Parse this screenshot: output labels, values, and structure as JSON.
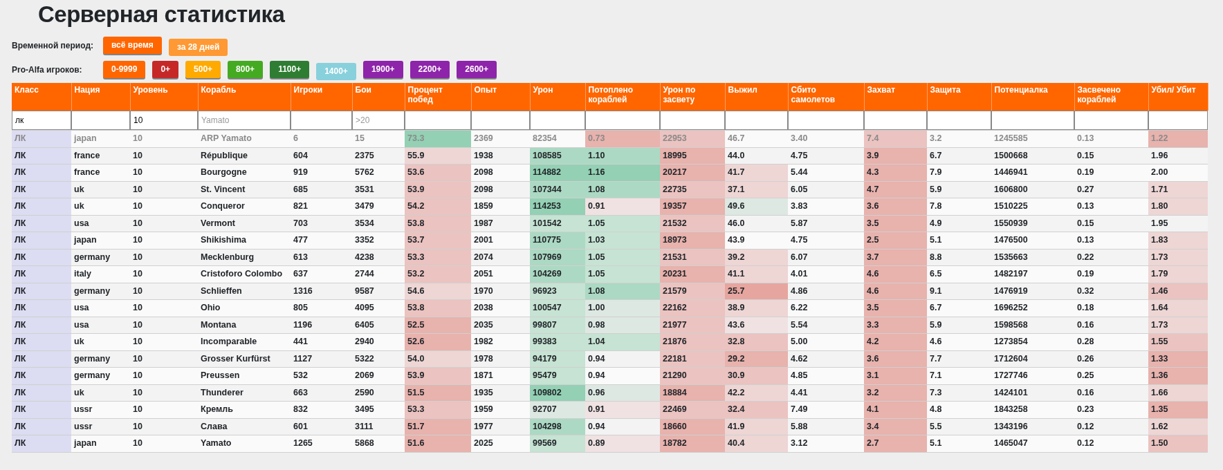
{
  "title": "Серверная статистика",
  "period": {
    "label": "Временной период:",
    "options": [
      {
        "label": "всё время",
        "selected": true,
        "color": "#ff6600"
      },
      {
        "label": "за 28 дней",
        "selected": false,
        "color": "#ff9933"
      }
    ]
  },
  "pro_alfa": {
    "label": "Pro-Alfa игроков:",
    "options": [
      {
        "label": "0-9999",
        "selected": true,
        "color": "#ff6600"
      },
      {
        "label": "0+",
        "selected": true,
        "color": "#c62828"
      },
      {
        "label": "500+",
        "selected": true,
        "color": "#ffaa00"
      },
      {
        "label": "800+",
        "selected": true,
        "color": "#44aa22"
      },
      {
        "label": "1100+",
        "selected": true,
        "color": "#2e7d32"
      },
      {
        "label": "1400+",
        "selected": false,
        "color": "#88d0dc"
      },
      {
        "label": "1900+",
        "selected": true,
        "color": "#8e24aa"
      },
      {
        "label": "2200+",
        "selected": true,
        "color": "#8e24aa"
      },
      {
        "label": "2600+",
        "selected": true,
        "color": "#8e24aa"
      }
    ]
  },
  "table": {
    "columns": [
      {
        "label": "Класс",
        "filter": "лк"
      },
      {
        "label": "Нация"
      },
      {
        "label": "Уровень",
        "filter": "10"
      },
      {
        "label": "Корабль",
        "placeholder": "Yamato"
      },
      {
        "label": "Игроки"
      },
      {
        "label": "Бои",
        "placeholder": ">20"
      },
      {
        "label": "Процент побед"
      },
      {
        "label": "Опыт"
      },
      {
        "label": "Урон"
      },
      {
        "label": "Потоплено кораблей"
      },
      {
        "label": "Урон по засвету"
      },
      {
        "label": "Выжил"
      },
      {
        "label": "Сбито самолетов"
      },
      {
        "label": "Захват"
      },
      {
        "label": "Защита"
      },
      {
        "label": "Потенциалка"
      },
      {
        "label": "Засвечено кораблей"
      },
      {
        "label": "Убил/ Убит"
      }
    ],
    "rows": [
      {
        "muted": true,
        "cells": [
          {
            "text": "ЛК"
          },
          {
            "text": "japan"
          },
          {
            "text": "10"
          },
          {
            "text": "ARP Yamato"
          },
          {
            "text": "6"
          },
          {
            "text": "15"
          },
          {
            "text": "73.3",
            "color": "#93d0b4"
          },
          {
            "text": "2369"
          },
          {
            "text": "82354"
          },
          {
            "text": "0.73",
            "color": "#e8b2ad"
          },
          {
            "text": "22953",
            "color": "#ebc3c0"
          },
          {
            "text": "46.7"
          },
          {
            "text": "3.40"
          },
          {
            "text": "7.4",
            "color": "#ebc3c0"
          },
          {
            "text": "3.2"
          },
          {
            "text": "1245585"
          },
          {
            "text": "0.13"
          },
          {
            "text": "1.22",
            "color": "#e8b2ad"
          }
        ]
      },
      {
        "muted": false,
        "cells": [
          {
            "text": "ЛК"
          },
          {
            "text": "france"
          },
          {
            "text": "10"
          },
          {
            "text": "République"
          },
          {
            "text": "604"
          },
          {
            "text": "2375"
          },
          {
            "text": "55.9",
            "color": "#eed6d5"
          },
          {
            "text": "1938"
          },
          {
            "text": "108585",
            "color": "#acd9c3"
          },
          {
            "text": "1.10",
            "color": "#acd9c3"
          },
          {
            "text": "18995",
            "color": "#e8b2ad"
          },
          {
            "text": "44.0"
          },
          {
            "text": "4.75"
          },
          {
            "text": "3.9",
            "color": "#e8b2ad"
          },
          {
            "text": "6.7"
          },
          {
            "text": "1500668"
          },
          {
            "text": "0.15"
          },
          {
            "text": "1.96"
          }
        ]
      },
      {
        "muted": false,
        "cells": [
          {
            "text": "ЛК"
          },
          {
            "text": "france"
          },
          {
            "text": "10"
          },
          {
            "text": "Bourgogne"
          },
          {
            "text": "919"
          },
          {
            "text": "5762"
          },
          {
            "text": "53.6",
            "color": "#ebc3c0"
          },
          {
            "text": "2098"
          },
          {
            "text": "114882",
            "color": "#93d0b4"
          },
          {
            "text": "1.16",
            "color": "#93d0b4"
          },
          {
            "text": "20217",
            "color": "#e8b2ad"
          },
          {
            "text": "41.7",
            "color": "#eed6d5"
          },
          {
            "text": "5.44"
          },
          {
            "text": "4.3",
            "color": "#e8b2ad"
          },
          {
            "text": "7.9"
          },
          {
            "text": "1446941"
          },
          {
            "text": "0.19"
          },
          {
            "text": "2.00"
          }
        ]
      },
      {
        "muted": false,
        "cells": [
          {
            "text": "ЛК"
          },
          {
            "text": "uk"
          },
          {
            "text": "10"
          },
          {
            "text": "St. Vincent"
          },
          {
            "text": "685"
          },
          {
            "text": "3531"
          },
          {
            "text": "53.9",
            "color": "#ebc3c0"
          },
          {
            "text": "2098"
          },
          {
            "text": "107344",
            "color": "#acd9c3"
          },
          {
            "text": "1.08",
            "color": "#acd9c3"
          },
          {
            "text": "22735",
            "color": "#ebc3c0"
          },
          {
            "text": "37.1",
            "color": "#eed6d5"
          },
          {
            "text": "6.05"
          },
          {
            "text": "4.7",
            "color": "#e8b2ad"
          },
          {
            "text": "5.9"
          },
          {
            "text": "1606800"
          },
          {
            "text": "0.27"
          },
          {
            "text": "1.71",
            "color": "#eed6d5"
          }
        ]
      },
      {
        "muted": false,
        "cells": [
          {
            "text": "ЛК"
          },
          {
            "text": "uk"
          },
          {
            "text": "10"
          },
          {
            "text": "Conqueror"
          },
          {
            "text": "821"
          },
          {
            "text": "3479"
          },
          {
            "text": "54.2",
            "color": "#ebc3c0"
          },
          {
            "text": "1859"
          },
          {
            "text": "114253",
            "color": "#93d0b4"
          },
          {
            "text": "0.91",
            "color": "#f0e2e2"
          },
          {
            "text": "19357",
            "color": "#e8b2ad"
          },
          {
            "text": "49.6",
            "color": "#dee8e3"
          },
          {
            "text": "3.83"
          },
          {
            "text": "3.6",
            "color": "#e8b2ad"
          },
          {
            "text": "7.8"
          },
          {
            "text": "1510225"
          },
          {
            "text": "0.13"
          },
          {
            "text": "1.80",
            "color": "#eed6d5"
          }
        ]
      },
      {
        "muted": false,
        "cells": [
          {
            "text": "ЛК"
          },
          {
            "text": "usa"
          },
          {
            "text": "10"
          },
          {
            "text": "Vermont"
          },
          {
            "text": "703"
          },
          {
            "text": "3534"
          },
          {
            "text": "53.8",
            "color": "#ebc3c0"
          },
          {
            "text": "1987"
          },
          {
            "text": "101542",
            "color": "#c6e3d3"
          },
          {
            "text": "1.05",
            "color": "#c6e3d3"
          },
          {
            "text": "21532",
            "color": "#ebc3c0"
          },
          {
            "text": "46.0"
          },
          {
            "text": "5.87"
          },
          {
            "text": "3.5",
            "color": "#e8b2ad"
          },
          {
            "text": "4.9"
          },
          {
            "text": "1550939"
          },
          {
            "text": "0.15"
          },
          {
            "text": "1.95"
          }
        ]
      },
      {
        "muted": false,
        "cells": [
          {
            "text": "ЛК"
          },
          {
            "text": "japan"
          },
          {
            "text": "10"
          },
          {
            "text": "Shikishima"
          },
          {
            "text": "477"
          },
          {
            "text": "3352"
          },
          {
            "text": "53.7",
            "color": "#ebc3c0"
          },
          {
            "text": "2001"
          },
          {
            "text": "110775",
            "color": "#acd9c3"
          },
          {
            "text": "1.03",
            "color": "#c6e3d3"
          },
          {
            "text": "18973",
            "color": "#e8b2ad"
          },
          {
            "text": "43.9"
          },
          {
            "text": "4.75"
          },
          {
            "text": "2.5",
            "color": "#e8b2ad"
          },
          {
            "text": "5.1"
          },
          {
            "text": "1476500"
          },
          {
            "text": "0.13"
          },
          {
            "text": "1.83",
            "color": "#eed6d5"
          }
        ]
      },
      {
        "muted": false,
        "cells": [
          {
            "text": "ЛК"
          },
          {
            "text": "germany"
          },
          {
            "text": "10"
          },
          {
            "text": "Mecklenburg"
          },
          {
            "text": "613"
          },
          {
            "text": "4238"
          },
          {
            "text": "53.3",
            "color": "#ebc3c0"
          },
          {
            "text": "2074"
          },
          {
            "text": "107969",
            "color": "#acd9c3"
          },
          {
            "text": "1.05",
            "color": "#c6e3d3"
          },
          {
            "text": "21531",
            "color": "#ebc3c0"
          },
          {
            "text": "39.2",
            "color": "#eed6d5"
          },
          {
            "text": "6.07"
          },
          {
            "text": "3.7",
            "color": "#e8b2ad"
          },
          {
            "text": "8.8"
          },
          {
            "text": "1535663"
          },
          {
            "text": "0.22"
          },
          {
            "text": "1.73",
            "color": "#eed6d5"
          }
        ]
      },
      {
        "muted": false,
        "cells": [
          {
            "text": "ЛК"
          },
          {
            "text": "italy"
          },
          {
            "text": "10"
          },
          {
            "text": "Cristoforo Colombo"
          },
          {
            "text": "637"
          },
          {
            "text": "2744"
          },
          {
            "text": "53.2",
            "color": "#ebc3c0"
          },
          {
            "text": "2051"
          },
          {
            "text": "104269",
            "color": "#acd9c3"
          },
          {
            "text": "1.05",
            "color": "#c6e3d3"
          },
          {
            "text": "20231",
            "color": "#e8b2ad"
          },
          {
            "text": "41.1",
            "color": "#eed6d5"
          },
          {
            "text": "4.01"
          },
          {
            "text": "4.6",
            "color": "#e8b2ad"
          },
          {
            "text": "6.5"
          },
          {
            "text": "1482197"
          },
          {
            "text": "0.19"
          },
          {
            "text": "1.79",
            "color": "#eed6d5"
          }
        ]
      },
      {
        "muted": false,
        "cells": [
          {
            "text": "ЛК"
          },
          {
            "text": "germany"
          },
          {
            "text": "10"
          },
          {
            "text": "Schlieffen"
          },
          {
            "text": "1316"
          },
          {
            "text": "9587"
          },
          {
            "text": "54.6",
            "color": "#eed6d5"
          },
          {
            "text": "1970"
          },
          {
            "text": "96923",
            "color": "#c6e3d3"
          },
          {
            "text": "1.08",
            "color": "#acd9c3"
          },
          {
            "text": "21579",
            "color": "#ebc3c0"
          },
          {
            "text": "25.7",
            "color": "#e6a59e"
          },
          {
            "text": "4.86"
          },
          {
            "text": "4.6",
            "color": "#e8b2ad"
          },
          {
            "text": "9.1"
          },
          {
            "text": "1476919"
          },
          {
            "text": "0.32"
          },
          {
            "text": "1.46",
            "color": "#ebc3c0"
          }
        ]
      },
      {
        "muted": false,
        "cells": [
          {
            "text": "ЛК"
          },
          {
            "text": "usa"
          },
          {
            "text": "10"
          },
          {
            "text": "Ohio"
          },
          {
            "text": "805"
          },
          {
            "text": "4095"
          },
          {
            "text": "53.8",
            "color": "#ebc3c0"
          },
          {
            "text": "2038"
          },
          {
            "text": "100547",
            "color": "#c6e3d3"
          },
          {
            "text": "1.00",
            "color": "#dee8e3"
          },
          {
            "text": "22162",
            "color": "#ebc3c0"
          },
          {
            "text": "38.9",
            "color": "#eed6d5"
          },
          {
            "text": "6.22"
          },
          {
            "text": "3.5",
            "color": "#e8b2ad"
          },
          {
            "text": "6.7"
          },
          {
            "text": "1696252"
          },
          {
            "text": "0.18"
          },
          {
            "text": "1.64",
            "color": "#eed6d5"
          }
        ]
      },
      {
        "muted": false,
        "cells": [
          {
            "text": "ЛК"
          },
          {
            "text": "usa"
          },
          {
            "text": "10"
          },
          {
            "text": "Montana"
          },
          {
            "text": "1196"
          },
          {
            "text": "6405"
          },
          {
            "text": "52.5",
            "color": "#e8b2ad"
          },
          {
            "text": "2035"
          },
          {
            "text": "99807",
            "color": "#c6e3d3"
          },
          {
            "text": "0.98",
            "color": "#dee8e3"
          },
          {
            "text": "21977",
            "color": "#ebc3c0"
          },
          {
            "text": "43.6",
            "color": "#f0e2e2"
          },
          {
            "text": "5.54"
          },
          {
            "text": "3.3",
            "color": "#e8b2ad"
          },
          {
            "text": "5.9"
          },
          {
            "text": "1598568"
          },
          {
            "text": "0.16"
          },
          {
            "text": "1.73",
            "color": "#eed6d5"
          }
        ]
      },
      {
        "muted": false,
        "cells": [
          {
            "text": "ЛК"
          },
          {
            "text": "uk"
          },
          {
            "text": "10"
          },
          {
            "text": "Incomparable"
          },
          {
            "text": "441"
          },
          {
            "text": "2940"
          },
          {
            "text": "52.6",
            "color": "#e8b2ad"
          },
          {
            "text": "1982"
          },
          {
            "text": "99383",
            "color": "#c6e3d3"
          },
          {
            "text": "1.04",
            "color": "#c6e3d3"
          },
          {
            "text": "21876",
            "color": "#ebc3c0"
          },
          {
            "text": "32.8",
            "color": "#ebc3c0"
          },
          {
            "text": "5.00"
          },
          {
            "text": "4.2",
            "color": "#e8b2ad"
          },
          {
            "text": "4.6"
          },
          {
            "text": "1273854"
          },
          {
            "text": "0.28"
          },
          {
            "text": "1.55",
            "color": "#ebc3c0"
          }
        ]
      },
      {
        "muted": false,
        "cells": [
          {
            "text": "ЛК"
          },
          {
            "text": "germany"
          },
          {
            "text": "10"
          },
          {
            "text": "Grosser Kurfürst"
          },
          {
            "text": "1127"
          },
          {
            "text": "5322"
          },
          {
            "text": "54.0",
            "color": "#eed6d5"
          },
          {
            "text": "1978"
          },
          {
            "text": "94179",
            "color": "#c6e3d3"
          },
          {
            "text": "0.94"
          },
          {
            "text": "22181",
            "color": "#ebc3c0"
          },
          {
            "text": "29.2",
            "color": "#e8b2ad"
          },
          {
            "text": "4.62"
          },
          {
            "text": "3.6",
            "color": "#e8b2ad"
          },
          {
            "text": "7.7"
          },
          {
            "text": "1712604"
          },
          {
            "text": "0.26"
          },
          {
            "text": "1.33",
            "color": "#e8b2ad"
          }
        ]
      },
      {
        "muted": false,
        "cells": [
          {
            "text": "ЛК"
          },
          {
            "text": "germany"
          },
          {
            "text": "10"
          },
          {
            "text": "Preussen"
          },
          {
            "text": "532"
          },
          {
            "text": "2069"
          },
          {
            "text": "53.9",
            "color": "#ebc3c0"
          },
          {
            "text": "1871"
          },
          {
            "text": "95479",
            "color": "#c6e3d3"
          },
          {
            "text": "0.94"
          },
          {
            "text": "21290",
            "color": "#ebc3c0"
          },
          {
            "text": "30.9",
            "color": "#ebc3c0"
          },
          {
            "text": "4.85"
          },
          {
            "text": "3.1",
            "color": "#e8b2ad"
          },
          {
            "text": "7.1"
          },
          {
            "text": "1727746"
          },
          {
            "text": "0.25"
          },
          {
            "text": "1.36",
            "color": "#e8b2ad"
          }
        ]
      },
      {
        "muted": false,
        "cells": [
          {
            "text": "ЛК"
          },
          {
            "text": "uk"
          },
          {
            "text": "10"
          },
          {
            "text": "Thunderer"
          },
          {
            "text": "663"
          },
          {
            "text": "2590"
          },
          {
            "text": "51.5",
            "color": "#e8b2ad"
          },
          {
            "text": "1935"
          },
          {
            "text": "109802",
            "color": "#93d0b4"
          },
          {
            "text": "0.96",
            "color": "#dee8e3"
          },
          {
            "text": "18884",
            "color": "#e8b2ad"
          },
          {
            "text": "42.2",
            "color": "#eed6d5"
          },
          {
            "text": "4.41"
          },
          {
            "text": "3.2",
            "color": "#e8b2ad"
          },
          {
            "text": "7.3"
          },
          {
            "text": "1424101"
          },
          {
            "text": "0.16"
          },
          {
            "text": "1.66",
            "color": "#eed6d5"
          }
        ]
      },
      {
        "muted": false,
        "cells": [
          {
            "text": "ЛК"
          },
          {
            "text": "ussr"
          },
          {
            "text": "10"
          },
          {
            "text": "Кремль"
          },
          {
            "text": "832"
          },
          {
            "text": "3495"
          },
          {
            "text": "53.3",
            "color": "#ebc3c0"
          },
          {
            "text": "1959"
          },
          {
            "text": "92707",
            "color": "#dee8e3"
          },
          {
            "text": "0.91",
            "color": "#f0e2e2"
          },
          {
            "text": "22469",
            "color": "#ebc3c0"
          },
          {
            "text": "32.4",
            "color": "#ebc3c0"
          },
          {
            "text": "7.49"
          },
          {
            "text": "4.1",
            "color": "#e8b2ad"
          },
          {
            "text": "4.8"
          },
          {
            "text": "1843258"
          },
          {
            "text": "0.23"
          },
          {
            "text": "1.35",
            "color": "#e8b2ad"
          }
        ]
      },
      {
        "muted": false,
        "cells": [
          {
            "text": "ЛК"
          },
          {
            "text": "ussr"
          },
          {
            "text": "10"
          },
          {
            "text": "Слава"
          },
          {
            "text": "601"
          },
          {
            "text": "3111"
          },
          {
            "text": "51.7",
            "color": "#e8b2ad"
          },
          {
            "text": "1977"
          },
          {
            "text": "104298",
            "color": "#acd9c3"
          },
          {
            "text": "0.94"
          },
          {
            "text": "18660",
            "color": "#e8b2ad"
          },
          {
            "text": "41.9",
            "color": "#eed6d5"
          },
          {
            "text": "5.88"
          },
          {
            "text": "3.4",
            "color": "#e8b2ad"
          },
          {
            "text": "5.5"
          },
          {
            "text": "1343196"
          },
          {
            "text": "0.12"
          },
          {
            "text": "1.62",
            "color": "#eed6d5"
          }
        ]
      },
      {
        "muted": false,
        "cells": [
          {
            "text": "ЛК"
          },
          {
            "text": "japan"
          },
          {
            "text": "10"
          },
          {
            "text": "Yamato"
          },
          {
            "text": "1265"
          },
          {
            "text": "5868"
          },
          {
            "text": "51.6",
            "color": "#e8b2ad"
          },
          {
            "text": "2025"
          },
          {
            "text": "99569",
            "color": "#c6e3d3"
          },
          {
            "text": "0.89",
            "color": "#f0e2e2"
          },
          {
            "text": "18782",
            "color": "#e8b2ad"
          },
          {
            "text": "40.4",
            "color": "#eed6d5"
          },
          {
            "text": "3.12"
          },
          {
            "text": "2.7",
            "color": "#e8b2ad"
          },
          {
            "text": "5.1"
          },
          {
            "text": "1465047"
          },
          {
            "text": "0.12"
          },
          {
            "text": "1.50",
            "color": "#ebc3c0"
          }
        ]
      }
    ]
  }
}
